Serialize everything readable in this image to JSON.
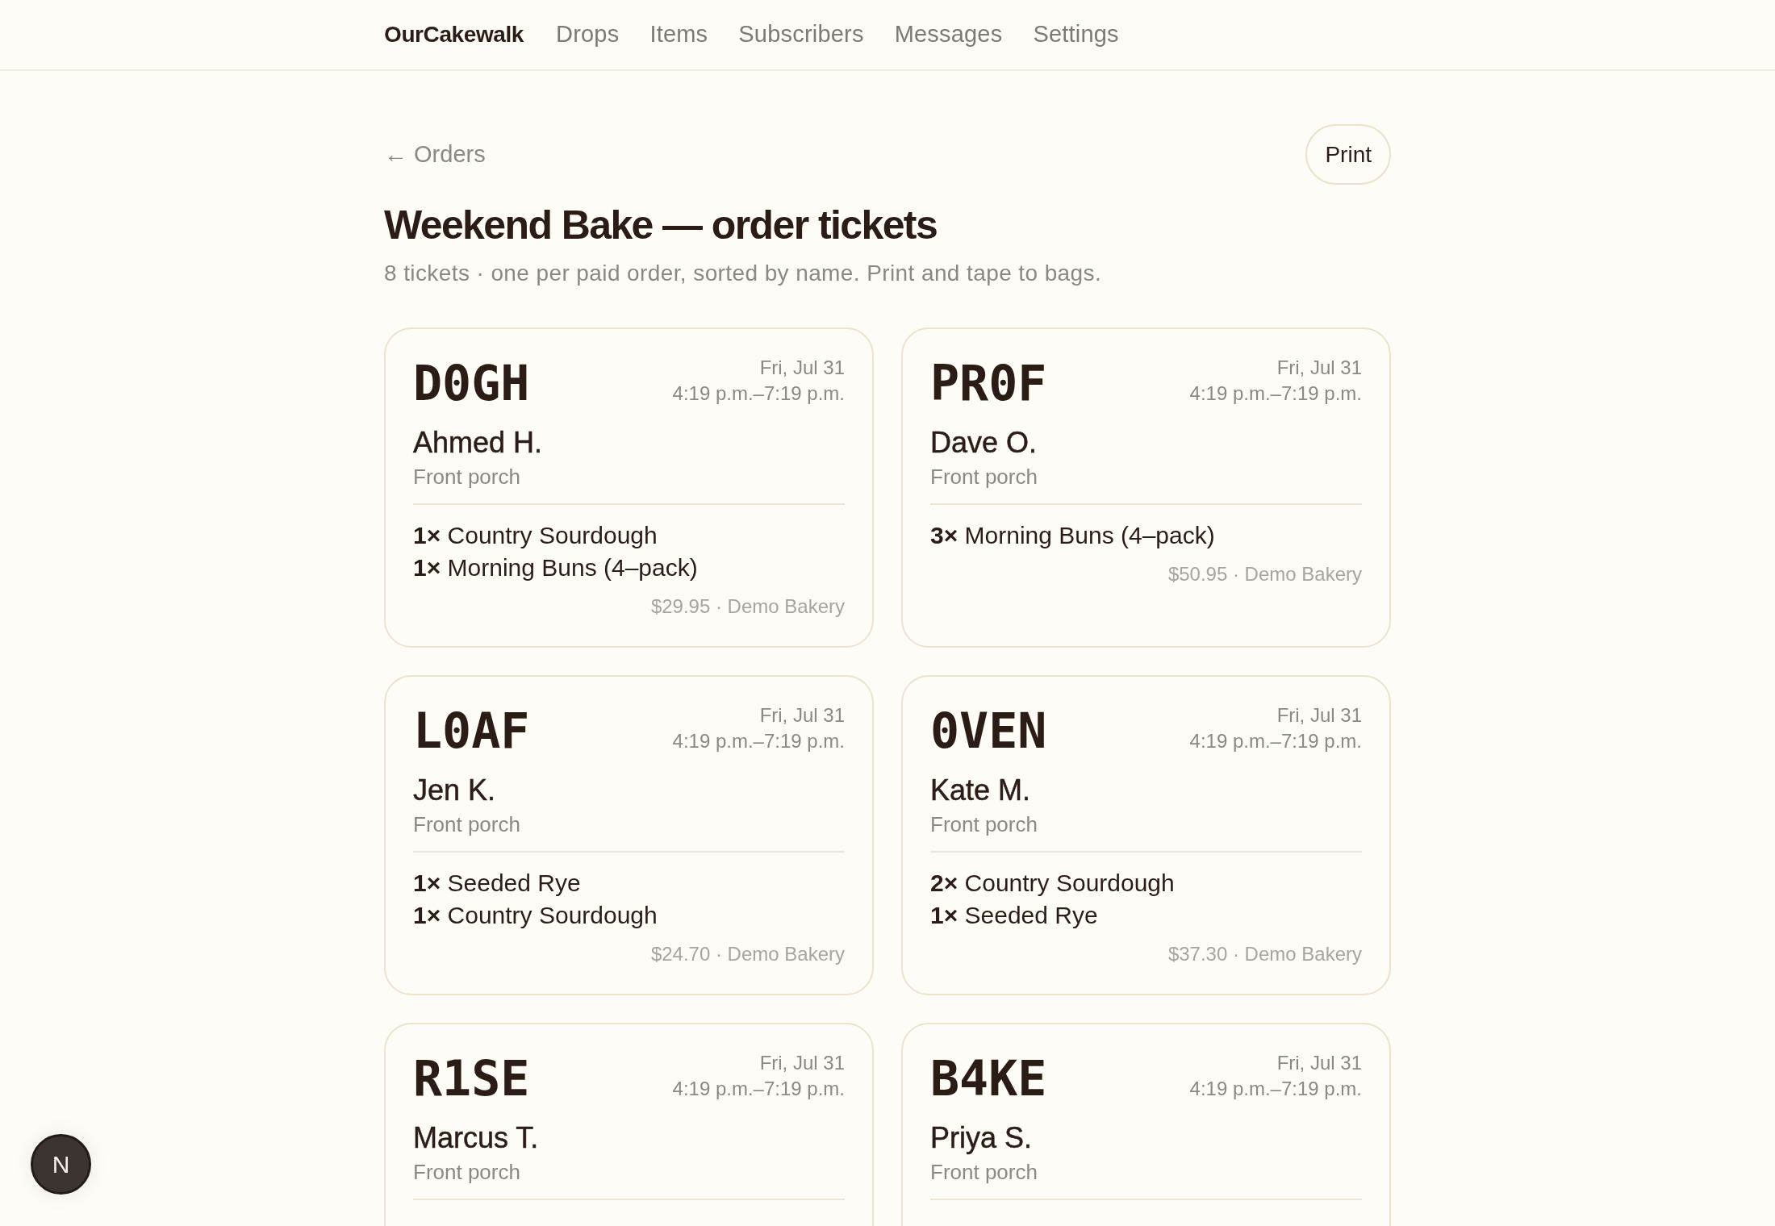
{
  "nav": {
    "brand": "OurCakewalk",
    "links": [
      "Drops",
      "Items",
      "Subscribers",
      "Messages",
      "Settings"
    ]
  },
  "header": {
    "back_link": "← Orders",
    "print_button": "Print",
    "title": "Weekend Bake — order tickets",
    "subtitle": "8 tickets · one per paid order, sorted by name. Print and tape to bags."
  },
  "tickets": [
    {
      "code": "D0GH",
      "date": "Fri, Jul 31",
      "time": "4:19 p.m.–7:19 p.m.",
      "name": "Ahmed H.",
      "location": "Front porch",
      "items": [
        "**1×** Country Sourdough",
        "**1×** Morning Buns (4–pack)"
      ],
      "footer": "$29.95 · Demo Bakery"
    },
    {
      "code": "PR0F",
      "date": "Fri, Jul 31",
      "time": "4:19 p.m.–7:19 p.m.",
      "name": "Dave O.",
      "location": "Front porch",
      "items": [
        "**3×** Morning Buns (4–pack)"
      ],
      "footer": "$50.95 · Demo Bakery"
    },
    {
      "code": "L0AF",
      "date": "Fri, Jul 31",
      "time": "4:19 p.m.–7:19 p.m.",
      "name": "Jen K.",
      "location": "Front porch",
      "items": [
        "**1×** Seeded Rye",
        "**1×** Country Sourdough"
      ],
      "footer": "$24.70 · Demo Bakery"
    },
    {
      "code": "0VEN",
      "date": "Fri, Jul 31",
      "time": "4:19 p.m.–7:19 p.m.",
      "name": "Kate M.",
      "location": "Front porch",
      "items": [
        "**2×** Country Sourdough",
        "**1×** Seeded Rye"
      ],
      "footer": "$37.30 · Demo Bakery"
    },
    {
      "code": "R1SE",
      "date": "Fri, Jul 31",
      "time": "4:19 p.m.–7:19 p.m.",
      "name": "Marcus T.",
      "location": "Front porch"
    },
    {
      "code": "B4KE",
      "date": "Fri, Jul 31",
      "time": "4:19 p.m.–7:19 p.m.",
      "name": "Priya S.",
      "location": "Front porch"
    }
  ],
  "dev_badge": {
    "label": "N"
  }
}
